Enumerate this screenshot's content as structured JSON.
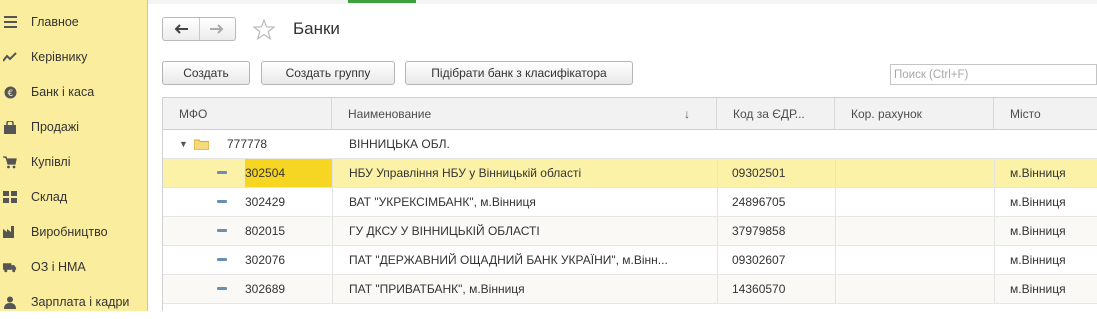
{
  "sidebar": {
    "items": [
      {
        "label": "Главное",
        "icon": "menu-lines-icon"
      },
      {
        "label": "Керівнику",
        "icon": "trend-chart-icon"
      },
      {
        "label": "Банк і каса",
        "icon": "coin-icon"
      },
      {
        "label": "Продажі",
        "icon": "shopping-bag-icon"
      },
      {
        "label": "Купівлі",
        "icon": "cart-icon"
      },
      {
        "label": "Склад",
        "icon": "warehouse-grid-icon"
      },
      {
        "label": "Виробництво",
        "icon": "factory-icon"
      },
      {
        "label": "ОЗ і НМА",
        "icon": "truck-icon"
      },
      {
        "label": "Зарплата і кадри",
        "icon": "person-icon"
      }
    ]
  },
  "header": {
    "title": "Банки"
  },
  "toolbar": {
    "create_label": "Создать",
    "create_group_label": "Создать группу",
    "pick_bank_label": "Підібрати банк з класифікатора",
    "search_placeholder": "Поиск (Ctrl+F)"
  },
  "table": {
    "columns": [
      "МФО",
      "Наименование",
      "Код за ЄДР...",
      "Кор. рахунок",
      "Місто"
    ],
    "group": {
      "mfo": "777778",
      "name": "ВІННИЦЬКА ОБЛ."
    },
    "rows": [
      {
        "mfo": "302504",
        "name": "НБУ Управління НБУ у Вінницькій області",
        "code": "09302501",
        "account": "",
        "city": "м.Вінниця"
      },
      {
        "mfo": "302429",
        "name": "ВАТ \"УКРЕКСІМБАНК\", м.Вінниця",
        "code": "24896705",
        "account": "",
        "city": "м.Вінниця"
      },
      {
        "mfo": "802015",
        "name": "ГУ ДКСУ У ВІННИЦЬКІЙ ОБЛАСТІ",
        "code": "37979858",
        "account": "",
        "city": "м.Вінниця"
      },
      {
        "mfo": "302076",
        "name": "ПАТ \"ДЕРЖАВНИЙ ОЩАДНИЙ БАНК УКРАЇНИ\", м.Вінн...",
        "code": "09302607",
        "account": "",
        "city": "м.Вінниця"
      },
      {
        "mfo": "302689",
        "name": "ПАТ \"ПРИВАТБАНК\", м.Вінниця",
        "code": "14360570",
        "account": "",
        "city": "м.Вінниця"
      }
    ]
  },
  "colors": {
    "sidebar_bg": "#fbed9e",
    "selected_row": "#fbf2a8",
    "selected_cell": "#f6d523",
    "accent_green": "#3ca03c"
  }
}
